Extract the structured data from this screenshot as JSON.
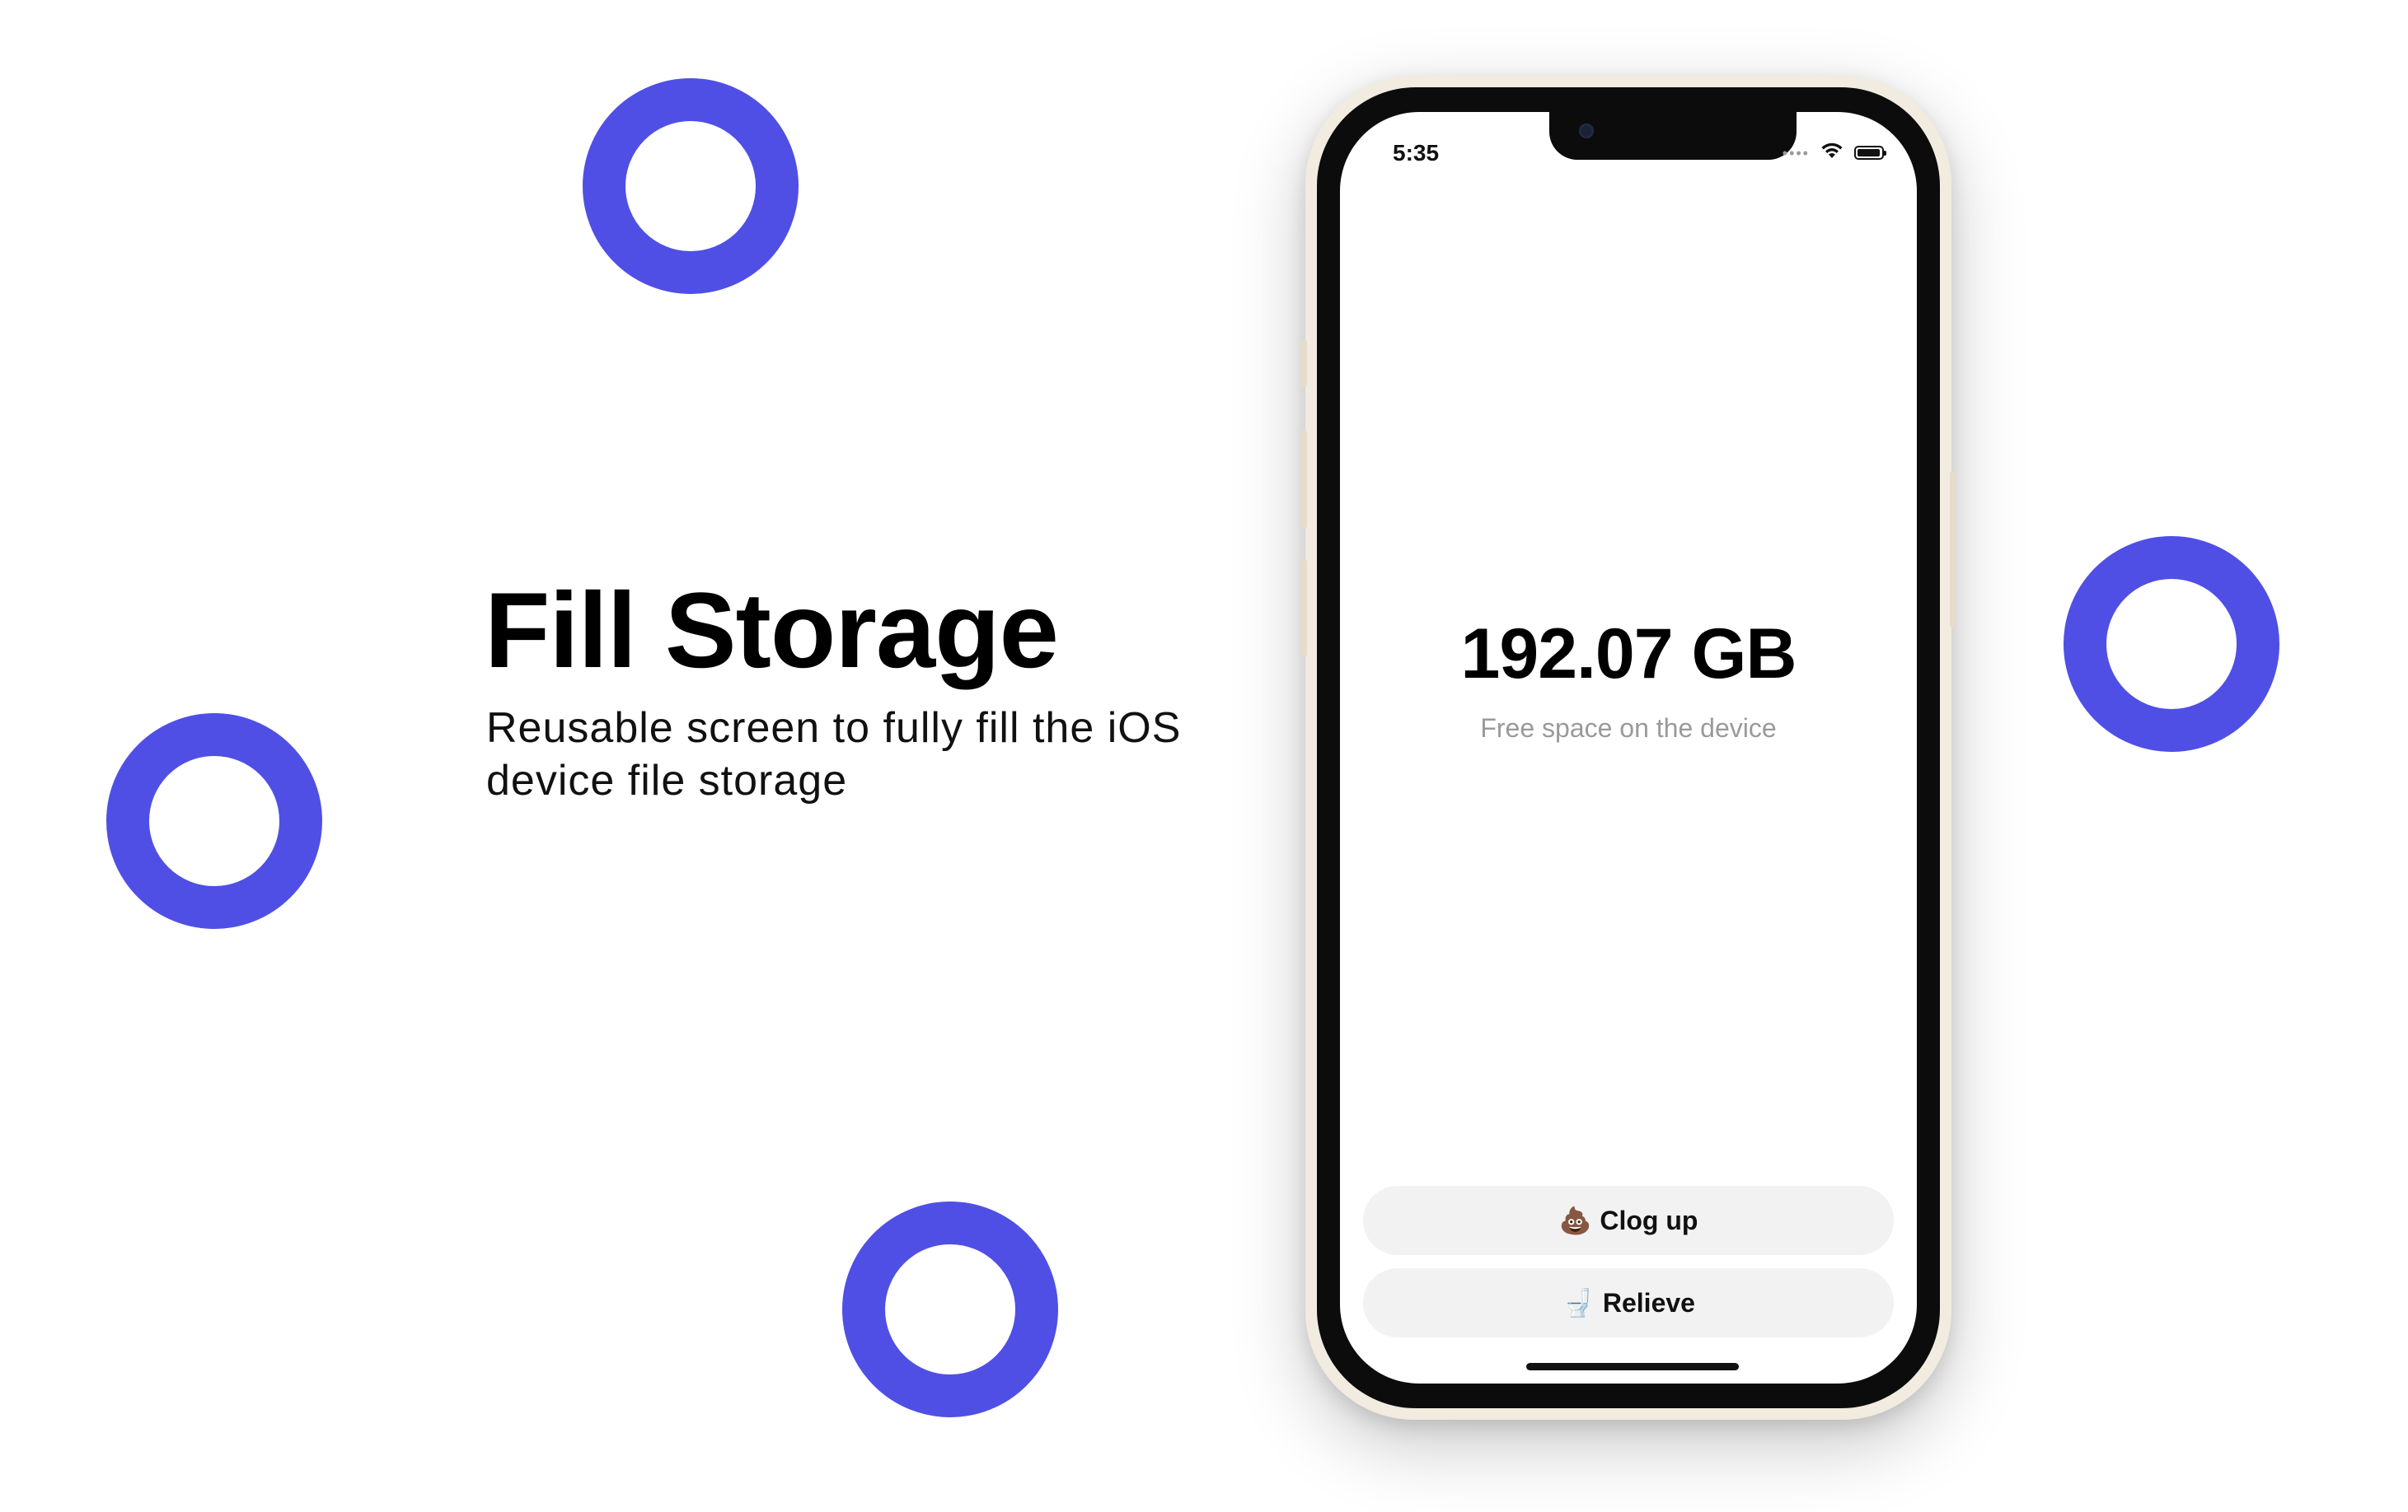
{
  "colors": {
    "accent_ring": "#4F4FE6",
    "background": "#FFFFFF",
    "phone_frame": "#F1EBE0",
    "button_bg": "#F2F2F2",
    "caption_gray": "#9A9A9A"
  },
  "hero": {
    "title": "Fill Storage",
    "subtitle": "Reusable screen to fully fill the iOS device file storage"
  },
  "status_bar": {
    "time": "5:35",
    "icons": [
      "cellular-signal-icon",
      "wifi-icon",
      "battery-icon"
    ]
  },
  "storage": {
    "free_space": "192.07 GB",
    "caption": "Free space on the device"
  },
  "actions": {
    "clog_up": {
      "icon": "💩",
      "label": "Clog up"
    },
    "relieve": {
      "icon": "🚽",
      "label": "Relieve"
    }
  }
}
